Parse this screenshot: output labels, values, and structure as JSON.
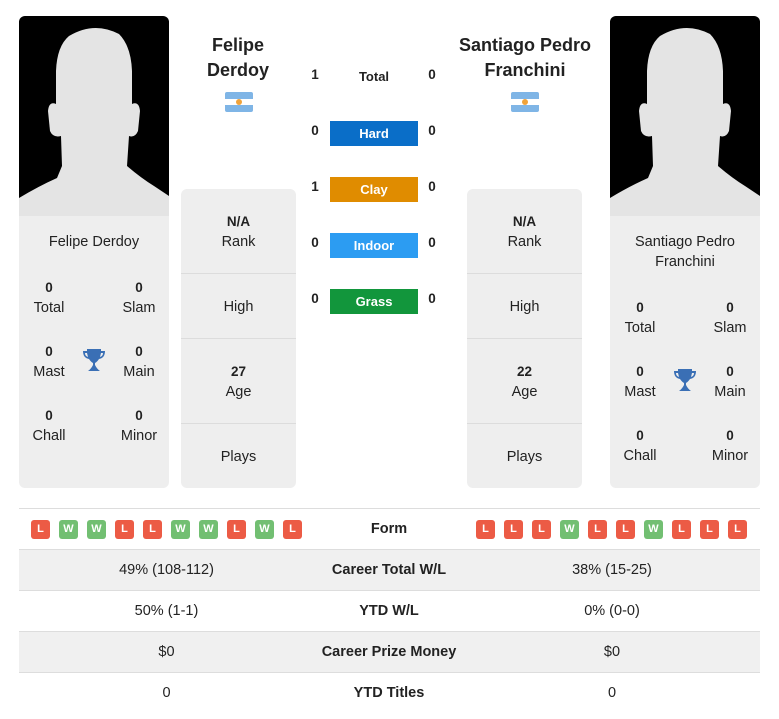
{
  "colors": {
    "hard": "#0a6ec8",
    "clay": "#e08c00",
    "indoor": "#2c9cf2",
    "grass": "#12963c",
    "win": "#72bf72",
    "loss": "#ec5b45",
    "trophy": "#3a6fb5"
  },
  "player1": {
    "name_line1": "Felipe",
    "name_line2": "Derdoy",
    "card_name": "Felipe Derdoy",
    "country_flag": "argentina-flag",
    "titles": {
      "total": {
        "value": "0",
        "label": "Total"
      },
      "slam": {
        "value": "0",
        "label": "Slam"
      },
      "mast": {
        "value": "0",
        "label": "Mast"
      },
      "main": {
        "value": "0",
        "label": "Main"
      },
      "chall": {
        "value": "0",
        "label": "Chall"
      },
      "minor": {
        "value": "0",
        "label": "Minor"
      }
    },
    "rank": {
      "value": "N/A",
      "label": "Rank"
    },
    "high": {
      "label": "High"
    },
    "age": {
      "value": "27",
      "label": "Age"
    },
    "plays": {
      "label": "Plays"
    },
    "form": [
      "L",
      "W",
      "W",
      "L",
      "L",
      "W",
      "W",
      "L",
      "W",
      "L"
    ],
    "career_wl": "49% (108-112)",
    "ytd_wl": "50% (1-1)",
    "prize_money": "$0",
    "ytd_titles": "0"
  },
  "player2": {
    "name_line1": "Santiago Pedro",
    "name_line2": "Franchini",
    "card_name_line1": "Santiago Pedro",
    "card_name_line2": "Franchini",
    "country_flag": "argentina-flag",
    "titles": {
      "total": {
        "value": "0",
        "label": "Total"
      },
      "slam": {
        "value": "0",
        "label": "Slam"
      },
      "mast": {
        "value": "0",
        "label": "Mast"
      },
      "main": {
        "value": "0",
        "label": "Main"
      },
      "chall": {
        "value": "0",
        "label": "Chall"
      },
      "minor": {
        "value": "0",
        "label": "Minor"
      }
    },
    "rank": {
      "value": "N/A",
      "label": "Rank"
    },
    "high": {
      "label": "High"
    },
    "age": {
      "value": "22",
      "label": "Age"
    },
    "plays": {
      "label": "Plays"
    },
    "form": [
      "L",
      "L",
      "L",
      "W",
      "L",
      "L",
      "W",
      "L",
      "L",
      "L"
    ],
    "career_wl": "38% (15-25)",
    "ytd_wl": "0% (0-0)",
    "prize_money": "$0",
    "ytd_titles": "0"
  },
  "h2h": {
    "total": {
      "label": "Total",
      "p1": "1",
      "p2": "0"
    },
    "hard": {
      "label": "Hard",
      "p1": "0",
      "p2": "0"
    },
    "clay": {
      "label": "Clay",
      "p1": "1",
      "p2": "0"
    },
    "indoor": {
      "label": "Indoor",
      "p1": "0",
      "p2": "0"
    },
    "grass": {
      "label": "Grass",
      "p1": "0",
      "p2": "0"
    }
  },
  "table": {
    "form_label": "Form",
    "career_wl_label": "Career Total W/L",
    "ytd_wl_label": "YTD W/L",
    "prize_label": "Career Prize Money",
    "ytd_titles_label": "YTD Titles"
  }
}
